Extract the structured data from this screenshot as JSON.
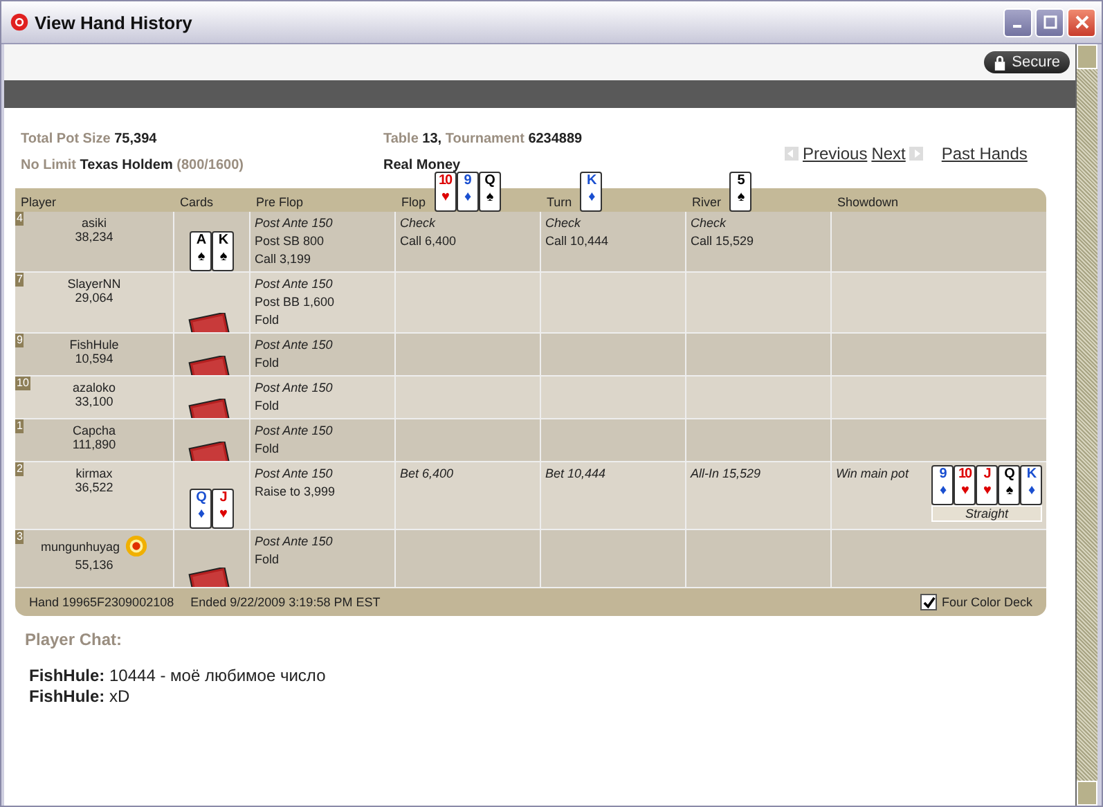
{
  "window": {
    "title": "View Hand History"
  },
  "secure_badge": "Secure",
  "info": {
    "pot_label": "Total Pot Size",
    "pot": "75,394",
    "limit": "No Limit",
    "game": "Texas Holdem",
    "blinds": "(800/1600)",
    "table_label": "Table",
    "table": "13,",
    "tournament_label": "Tournament",
    "tournament": "6234889",
    "money": "Real Money"
  },
  "nav": {
    "previous": "Previous",
    "next": "Next",
    "past": "Past Hands"
  },
  "columns": [
    "Player",
    "Cards",
    "Pre Flop",
    "Flop",
    "Turn",
    "River",
    "Showdown"
  ],
  "board": {
    "flop": [
      {
        "rank": "10",
        "suit": "♥",
        "color": "#dd0000"
      },
      {
        "rank": "9",
        "suit": "♦",
        "color": "#1a4fd0"
      },
      {
        "rank": "Q",
        "suit": "♠",
        "color": "#000000"
      }
    ],
    "turn": [
      {
        "rank": "K",
        "suit": "♦",
        "color": "#1a4fd0"
      }
    ],
    "river": [
      {
        "rank": "5",
        "suit": "♠",
        "color": "#000000"
      }
    ]
  },
  "rows": [
    {
      "seat": "4",
      "name": "asiki",
      "chips": "38,234",
      "dealer": false,
      "cards": [
        {
          "rank": "A",
          "suit": "♠",
          "color": "#000000"
        },
        {
          "rank": "K",
          "suit": "♠",
          "color": "#000000"
        }
      ],
      "preflop": [
        {
          "text": "Post Ante 150",
          "italic": true
        },
        {
          "text": "Post SB 800",
          "italic": false
        },
        {
          "text": "Call 3,199",
          "italic": false
        }
      ],
      "flop": [
        {
          "text": "Check",
          "italic": true
        },
        {
          "text": "Call 6,400",
          "italic": false
        }
      ],
      "turn": [
        {
          "text": "Check",
          "italic": true
        },
        {
          "text": "Call 10,444",
          "italic": false
        }
      ],
      "river": [
        {
          "text": "Check",
          "italic": true
        },
        {
          "text": "Call 15,529",
          "italic": false
        }
      ],
      "showdown": []
    },
    {
      "seat": "7",
      "name": "SlayerNN",
      "chips": "29,064",
      "dealer": false,
      "cards": [],
      "preflop": [
        {
          "text": "Post Ante 150",
          "italic": true
        },
        {
          "text": "Post BB 1,600",
          "italic": false
        },
        {
          "text": "Fold",
          "italic": false
        }
      ],
      "flop": [],
      "turn": [],
      "river": [],
      "showdown": []
    },
    {
      "seat": "9",
      "name": "FishHule",
      "chips": "10,594",
      "dealer": false,
      "cards": [],
      "preflop": [
        {
          "text": "Post Ante 150",
          "italic": true
        },
        {
          "text": "Fold",
          "italic": false
        }
      ],
      "flop": [],
      "turn": [],
      "river": [],
      "showdown": []
    },
    {
      "seat": "10",
      "name": "azaloko",
      "chips": "33,100",
      "dealer": false,
      "cards": [],
      "preflop": [
        {
          "text": "Post Ante 150",
          "italic": true
        },
        {
          "text": "Fold",
          "italic": false
        }
      ],
      "flop": [],
      "turn": [],
      "river": [],
      "showdown": []
    },
    {
      "seat": "1",
      "name": "Capcha",
      "chips": "111,890",
      "dealer": false,
      "cards": [],
      "preflop": [
        {
          "text": "Post Ante 150",
          "italic": true
        },
        {
          "text": "Fold",
          "italic": false
        }
      ],
      "flop": [],
      "turn": [],
      "river": [],
      "showdown": []
    },
    {
      "seat": "2",
      "name": "kirmax",
      "chips": "36,522",
      "dealer": false,
      "cards": [
        {
          "rank": "Q",
          "suit": "♦",
          "color": "#1a4fd0"
        },
        {
          "rank": "J",
          "suit": "♥",
          "color": "#dd0000"
        }
      ],
      "preflop": [
        {
          "text": "Post Ante 150",
          "italic": true
        },
        {
          "text": "Raise to 3,999",
          "italic": false
        }
      ],
      "flop": [
        {
          "text": "Bet 6,400",
          "italic": true
        }
      ],
      "turn": [
        {
          "text": "Bet 10,444",
          "italic": true
        }
      ],
      "river": [
        {
          "text": "All-In 15,529",
          "italic": true
        }
      ],
      "showdown": [
        {
          "text": "Win main pot",
          "italic": true
        }
      ],
      "best_hand": {
        "cards": [
          {
            "rank": "9",
            "suit": "♦",
            "color": "#1a4fd0"
          },
          {
            "rank": "10",
            "suit": "♥",
            "color": "#dd0000"
          },
          {
            "rank": "J",
            "suit": "♥",
            "color": "#dd0000"
          },
          {
            "rank": "Q",
            "suit": "♠",
            "color": "#000000"
          },
          {
            "rank": "K",
            "suit": "♦",
            "color": "#1a4fd0"
          }
        ],
        "label": "Straight"
      }
    },
    {
      "seat": "3",
      "name": "mungunhuyag",
      "chips": "55,136",
      "dealer": true,
      "cards": [],
      "preflop": [
        {
          "text": "Post Ante 150",
          "italic": true
        },
        {
          "text": "Fold",
          "italic": false
        }
      ],
      "flop": [],
      "turn": [],
      "river": [],
      "showdown": []
    }
  ],
  "footer": {
    "hand": "Hand 19965F2309002108",
    "ended": "Ended 9/22/2009 3:19:58 PM EST",
    "four_color": {
      "label": "Four Color Deck",
      "checked": true
    }
  },
  "chat": {
    "title": "Player Chat:",
    "lines": [
      {
        "name": "FishHule:",
        "text": "10444 - моё любимое число"
      },
      {
        "name": "FishHule:",
        "text": "xD"
      }
    ]
  }
}
